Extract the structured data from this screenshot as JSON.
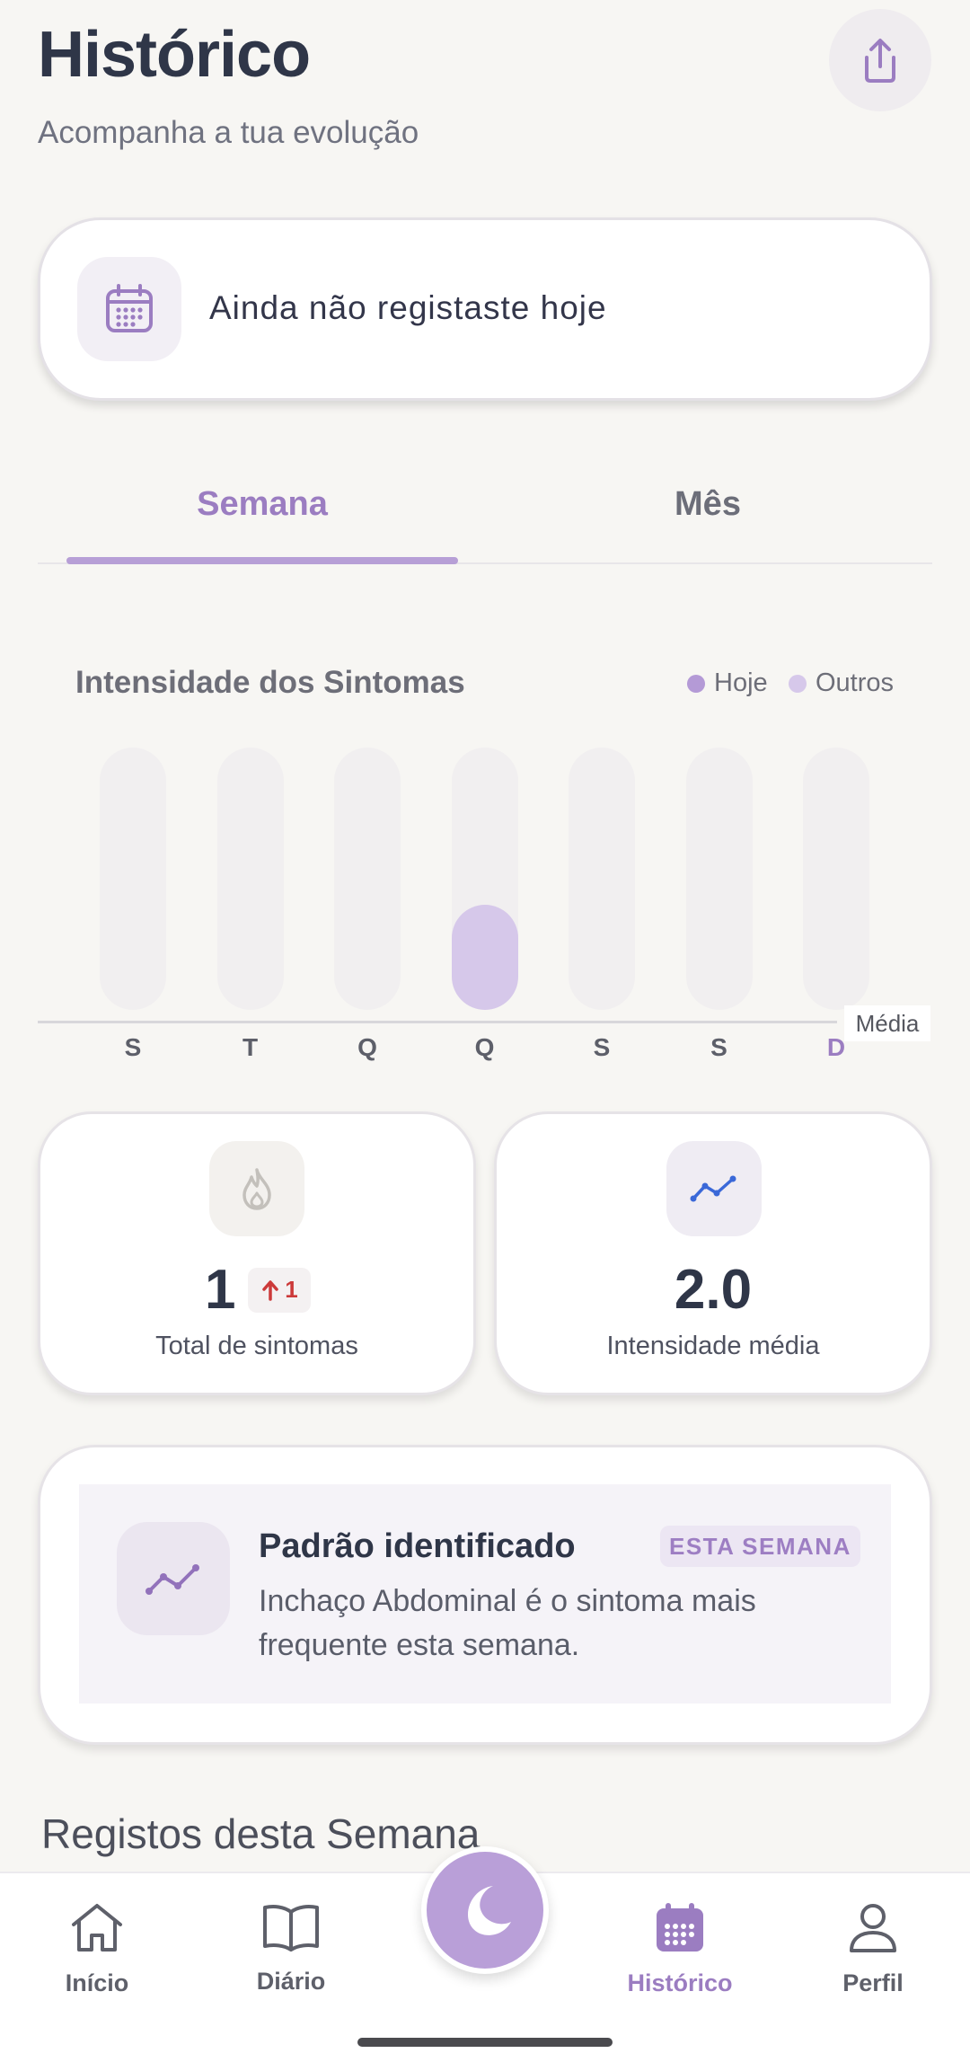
{
  "header": {
    "title": "Histórico",
    "subtitle": "Acompanha a tua evolução",
    "share_icon": "share-icon"
  },
  "today_card": {
    "icon": "calendar-icon",
    "text": "Ainda não registaste hoje"
  },
  "tabs": [
    {
      "label": "Semana",
      "active": true
    },
    {
      "label": "Mês",
      "active": false
    }
  ],
  "chart_data": {
    "type": "bar",
    "title": "Intensidade dos Sintomas",
    "legend": [
      {
        "label": "Hoje",
        "color": "#b49ad6"
      },
      {
        "label": "Outros",
        "color": "#d6c8ea"
      }
    ],
    "categories": [
      "S",
      "T",
      "Q",
      "Q",
      "S",
      "S",
      "D"
    ],
    "values": [
      0,
      0,
      0,
      2,
      0,
      0,
      0
    ],
    "ylim": [
      0,
      5
    ],
    "average_label": "Média",
    "highlighted_category_index": 6,
    "grid": false
  },
  "stats": {
    "total": {
      "icon": "flame-icon",
      "value": "1",
      "delta": "1",
      "delta_icon": "arrow-up-icon",
      "caption": "Total de sintomas"
    },
    "intensity": {
      "icon": "trend-line-icon",
      "value": "2.0",
      "caption": "Intensidade média"
    }
  },
  "pattern": {
    "icon": "trend-line-icon",
    "title": "Padrão identificado",
    "badge": "ESTA SEMANA",
    "description": "Inchaço Abdominal é o sintoma mais frequente esta semana."
  },
  "section_title": "Registos desta Semana",
  "bottom_nav": {
    "items": [
      {
        "label": "Início",
        "icon": "home-icon",
        "active": false
      },
      {
        "label": "Diário",
        "icon": "book-icon",
        "active": false
      },
      {
        "label": "Histórico",
        "icon": "calendar-icon",
        "active": true
      },
      {
        "label": "Perfil",
        "icon": "user-icon",
        "active": false
      }
    ],
    "center_icon": "moon-icon"
  },
  "colors": {
    "accent": "#9b7dc1",
    "accent_light": "#d6c8ea",
    "background": "#f7f6f3",
    "delta_red": "#cc3a3a",
    "trend_blue": "#3a68d8"
  }
}
